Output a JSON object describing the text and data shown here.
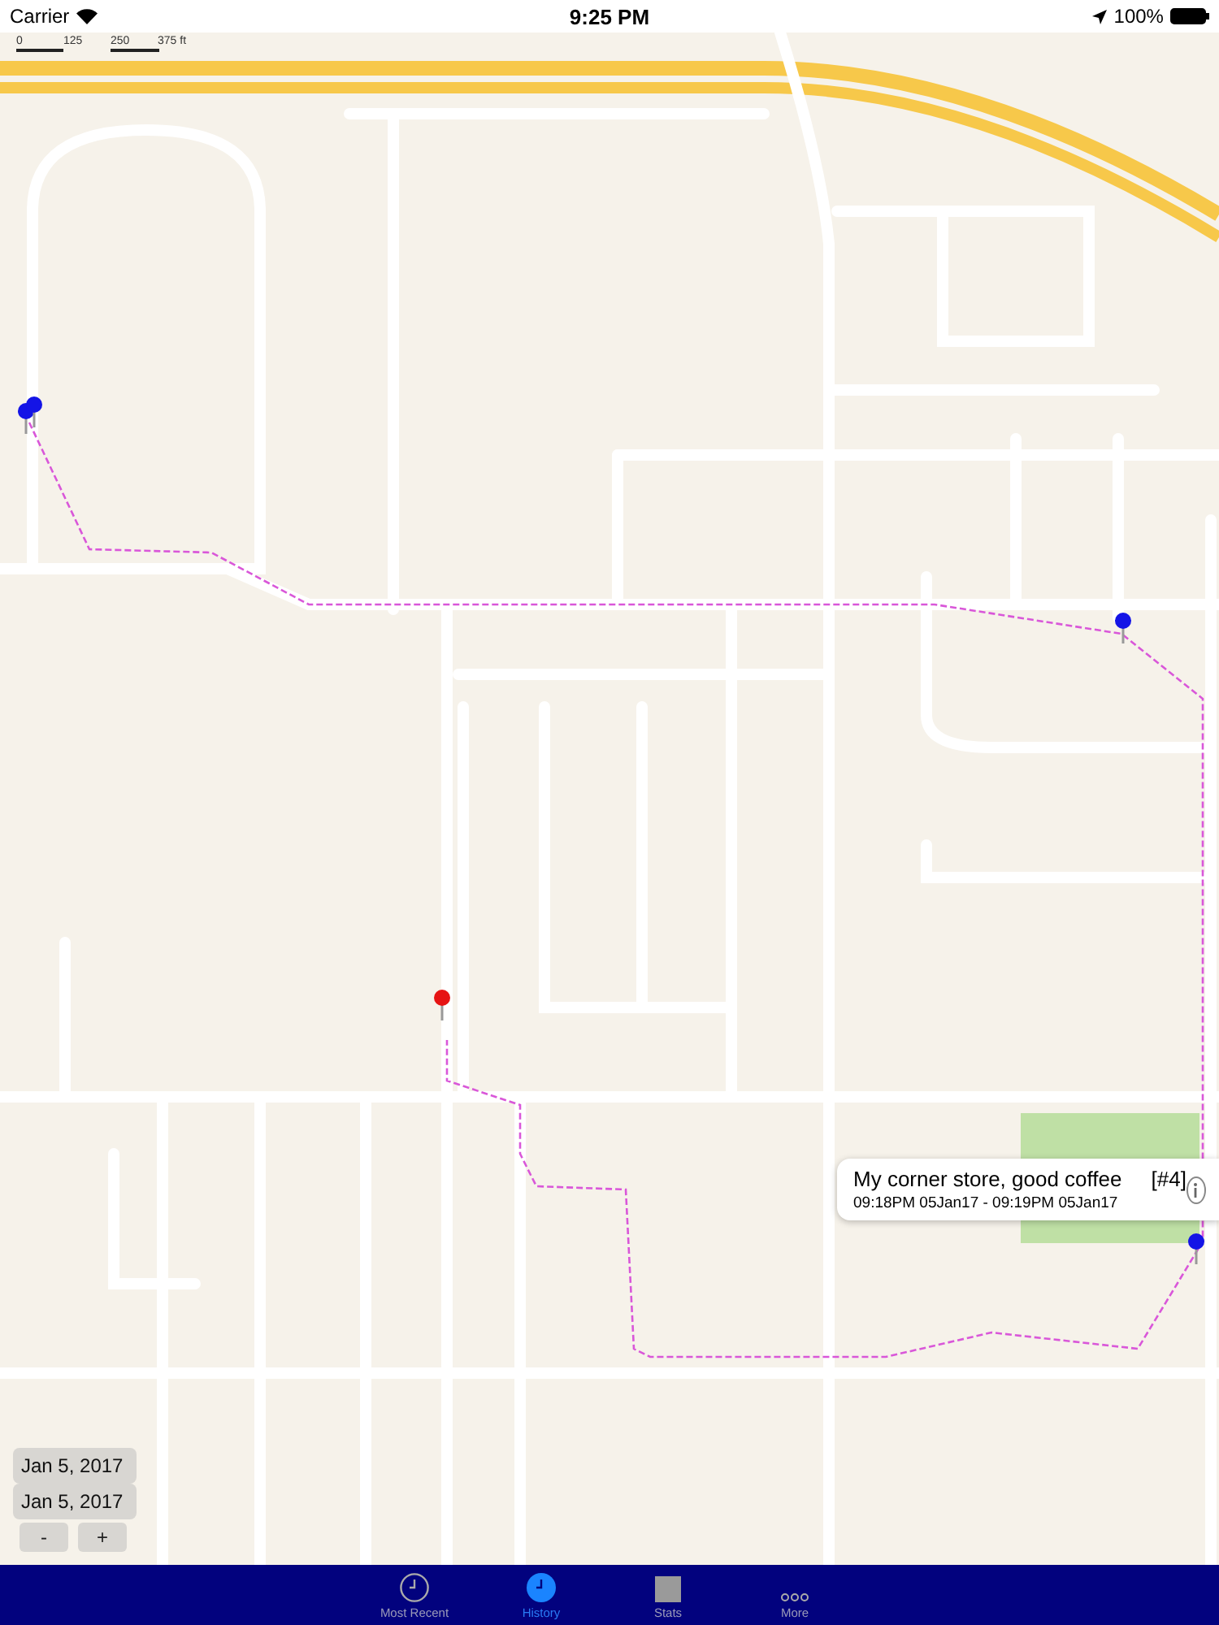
{
  "status_bar": {
    "carrier": "Carrier",
    "time": "9:25 PM",
    "battery": "100%"
  },
  "scale_bar": {
    "ticks": [
      "0",
      "125",
      "250",
      "375 ft"
    ]
  },
  "pins": [
    {
      "color": "#1414e6"
    },
    {
      "color": "#1414e6"
    },
    {
      "color": "#1414e6"
    },
    {
      "color": "#e61414"
    },
    {
      "color": "#1414e6"
    }
  ],
  "callout": {
    "title": "My corner store, good coffee",
    "number": "[#4]",
    "subtitle": "09:18PM 05Jan17 - 09:19PM 05Jan17"
  },
  "date_range": {
    "start": "Jan 5, 2017",
    "end": "Jan 5, 2017"
  },
  "zoom_buttons": [
    "-",
    "+"
  ],
  "tabs": [
    {
      "label": "Most Recent",
      "selected": false,
      "kind": "clock"
    },
    {
      "label": "History",
      "selected": true,
      "kind": "clock"
    },
    {
      "label": "Stats",
      "selected": false,
      "kind": "square"
    },
    {
      "label": "More",
      "selected": false,
      "kind": "dots"
    }
  ]
}
